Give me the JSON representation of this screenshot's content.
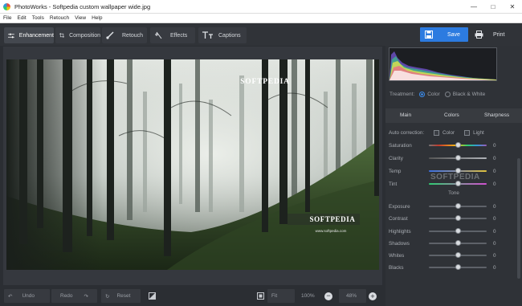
{
  "title": "PhotoWorks - Softpedia custom wallpaper wide.jpg",
  "menu": [
    "File",
    "Edit",
    "Tools",
    "Retouch",
    "View",
    "Help"
  ],
  "tabs": [
    {
      "label": "Enhancement",
      "icon": "sliders-icon"
    },
    {
      "label": "Composition",
      "icon": "crop-icon"
    },
    {
      "label": "Retouch",
      "icon": "brush-icon"
    },
    {
      "label": "Effects",
      "icon": "sparkle-icon"
    },
    {
      "label": "Captions",
      "icon": "text-icon"
    }
  ],
  "actions": {
    "save": "Save",
    "print": "Print"
  },
  "photo": {
    "watermark_top": "SOFTPEDIA",
    "watermark_bottom": "SOFTPEDIA",
    "url": "www.softpedia.com"
  },
  "panel": {
    "treatment_label": "Treatment:",
    "treatment_options": [
      "Color",
      "Black & White"
    ],
    "treatment_selected": "Color",
    "subtabs": [
      "Main",
      "Colors",
      "Sharpness"
    ],
    "active_subtab": "Main",
    "watermark": "SOFTPEDIA",
    "auto_correction_label": "Auto correction:",
    "auto_options": [
      "Color",
      "Light"
    ],
    "color_sliders": [
      {
        "name": "Saturation",
        "value": "0"
      },
      {
        "name": "Clarity",
        "value": "0"
      },
      {
        "name": "Temp",
        "value": "0"
      },
      {
        "name": "Tint",
        "value": "0"
      }
    ],
    "tone_label": "Tone",
    "tone_sliders": [
      {
        "name": "Exposure",
        "value": "0"
      },
      {
        "name": "Contrast",
        "value": "0"
      },
      {
        "name": "Highlights",
        "value": "0"
      },
      {
        "name": "Shadows",
        "value": "0"
      },
      {
        "name": "Whites",
        "value": "0"
      },
      {
        "name": "Blacks",
        "value": "0"
      }
    ]
  },
  "bottom": {
    "undo": "Undo",
    "redo": "Redo",
    "reset": "Reset",
    "fit": "Fit",
    "zoom_100": "100%",
    "zoom_value": "48%"
  },
  "colors": {
    "accent": "#2c7be0",
    "panel": "#2f3237",
    "background": "#2b2e33"
  }
}
